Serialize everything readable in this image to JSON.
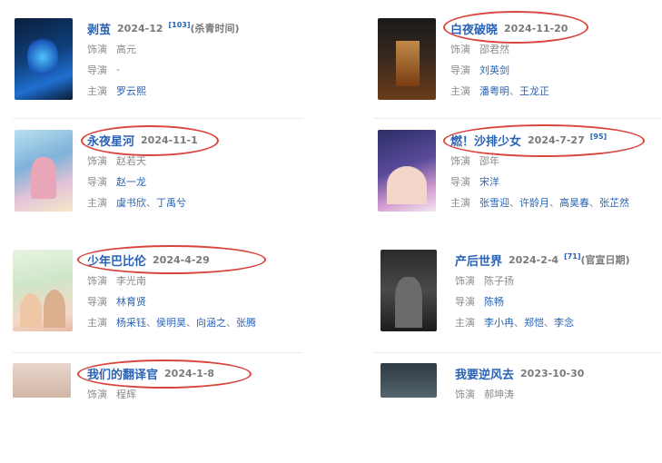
{
  "entries": [
    {
      "title": "剥茧",
      "date": "2024-12",
      "ref": "[103]",
      "note": "(杀青时间)",
      "role_label": "饰演",
      "role": "高元",
      "director_label": "导演",
      "director": "-",
      "cast_label": "主演",
      "cast": [
        "罗云熙"
      ]
    },
    {
      "title": "白夜破晓",
      "date": "2024-11-20",
      "role_label": "饰演",
      "role": "邵君然",
      "director_label": "导演",
      "director": "刘英剑",
      "cast_label": "主演",
      "cast": [
        "潘粤明",
        "王龙正"
      ]
    },
    {
      "title": "永夜星河",
      "date": "2024-11-1",
      "role_label": "饰演",
      "role": "赵若天",
      "director_label": "导演",
      "director": "赵一龙",
      "cast_label": "主演",
      "cast": [
        "虞书欣",
        "丁禹兮"
      ]
    },
    {
      "title": "燃！沙排少女",
      "date": "2024-7-27",
      "ref": "[95]",
      "role_label": "饰演",
      "role": "邵年",
      "director_label": "导演",
      "director": "宋洋",
      "cast_label": "主演",
      "cast": [
        "张雪迎",
        "许龄月",
        "高昊春",
        "张芷然"
      ]
    },
    {
      "title": "少年巴比伦",
      "date": "2024-4-29",
      "role_label": "饰演",
      "role": "李光南",
      "director_label": "导演",
      "director": "林育贤",
      "cast_label": "主演",
      "cast": [
        "杨采钰",
        "侯明昊",
        "向涵之",
        "张腾"
      ]
    },
    {
      "title": "产后世界",
      "date": "2024-2-4",
      "ref": "[71]",
      "note": "(官宣日期)",
      "role_label": "饰演",
      "role": "陈子扬",
      "director_label": "导演",
      "director": "陈畅",
      "cast_label": "主演",
      "cast": [
        "李小冉",
        "郑恺",
        "李念"
      ]
    },
    {
      "title": "我们的翻译官",
      "date": "2024-1-8",
      "role_label": "饰演",
      "role": "程辉"
    },
    {
      "title": "我要逆风去",
      "date": "2023-10-30",
      "role_label": "饰演",
      "role": "郝坤涛"
    }
  ],
  "colors": {
    "link": "#2a63b5",
    "highlight": "#d9443c",
    "muted": "#8a8a8a"
  }
}
